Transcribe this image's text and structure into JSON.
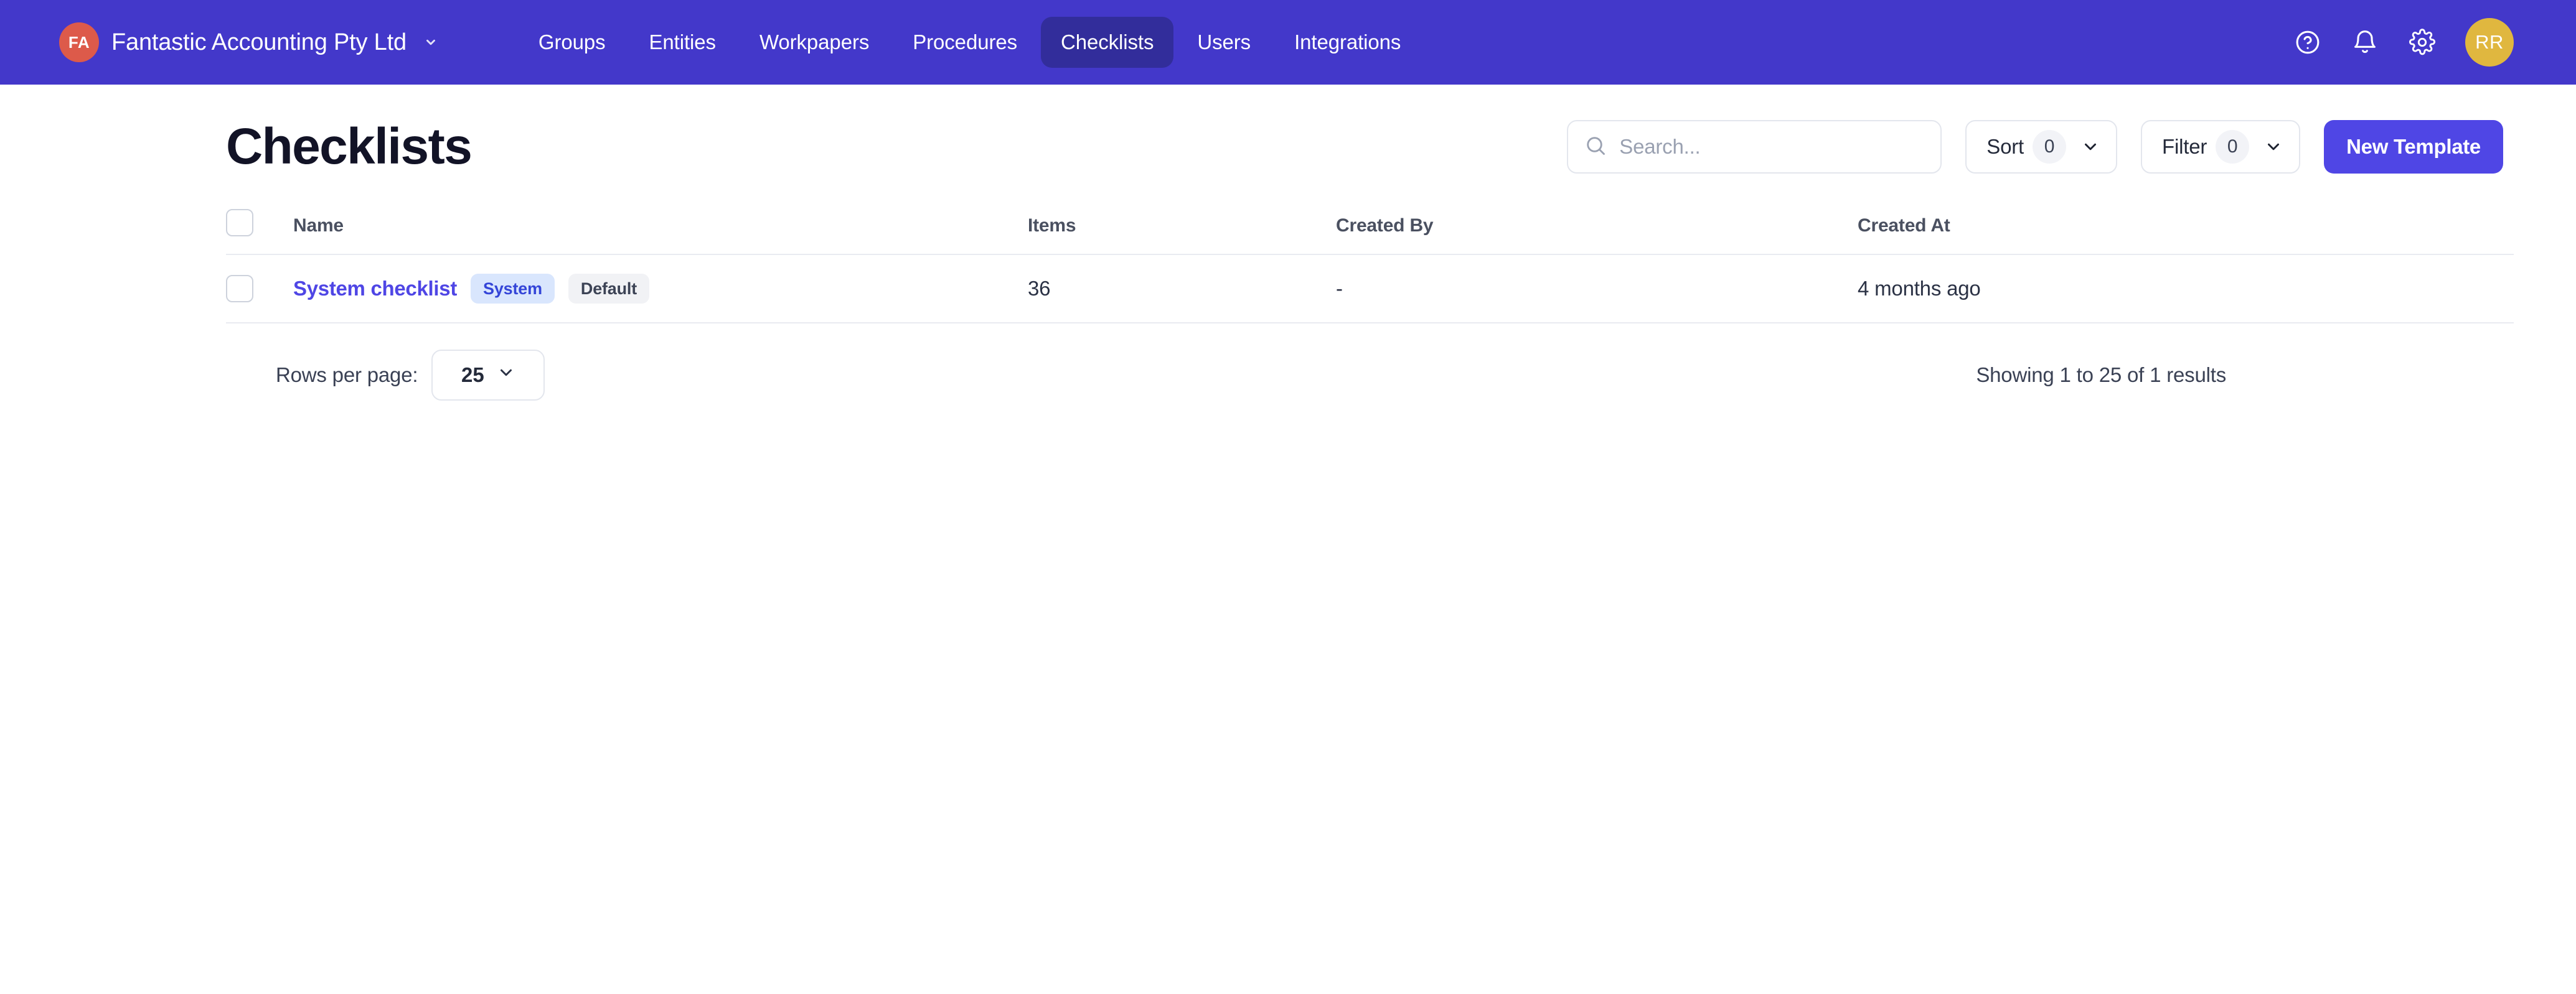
{
  "topnav": {
    "brand": {
      "initials": "FA",
      "name": "Fantastic Accounting Pty Ltd"
    },
    "links": [
      {
        "label": "Groups",
        "active": false
      },
      {
        "label": "Entities",
        "active": false
      },
      {
        "label": "Workpapers",
        "active": false
      },
      {
        "label": "Procedures",
        "active": false
      },
      {
        "label": "Checklists",
        "active": true
      },
      {
        "label": "Users",
        "active": false
      },
      {
        "label": "Integrations",
        "active": false
      }
    ],
    "user_initials": "RR",
    "colors": {
      "bar": "#4338ca",
      "active_tab": "#322d9b",
      "brand_avatar": "#dd5a4a",
      "user_avatar": "#e0b73f"
    }
  },
  "page": {
    "title": "Checklists"
  },
  "toolbar": {
    "search_placeholder": "Search...",
    "search_value": "",
    "sort_label": "Sort",
    "sort_count": "0",
    "filter_label": "Filter",
    "filter_count": "0",
    "new_template_label": "New Template",
    "primary_color": "#4f46e5"
  },
  "table": {
    "headers": {
      "name": "Name",
      "items": "Items",
      "created_by": "Created By",
      "created_at": "Created At"
    },
    "rows": [
      {
        "name": "System checklist",
        "tags": [
          {
            "label": "System",
            "style": "system"
          },
          {
            "label": "Default",
            "style": "default"
          }
        ],
        "items": "36",
        "created_by": "-",
        "created_at": "4 months ago"
      }
    ]
  },
  "footer": {
    "rows_per_page_label": "Rows per page:",
    "rows_per_page_value": "25",
    "showing_text": "Showing 1 to 25 of 1 results"
  }
}
